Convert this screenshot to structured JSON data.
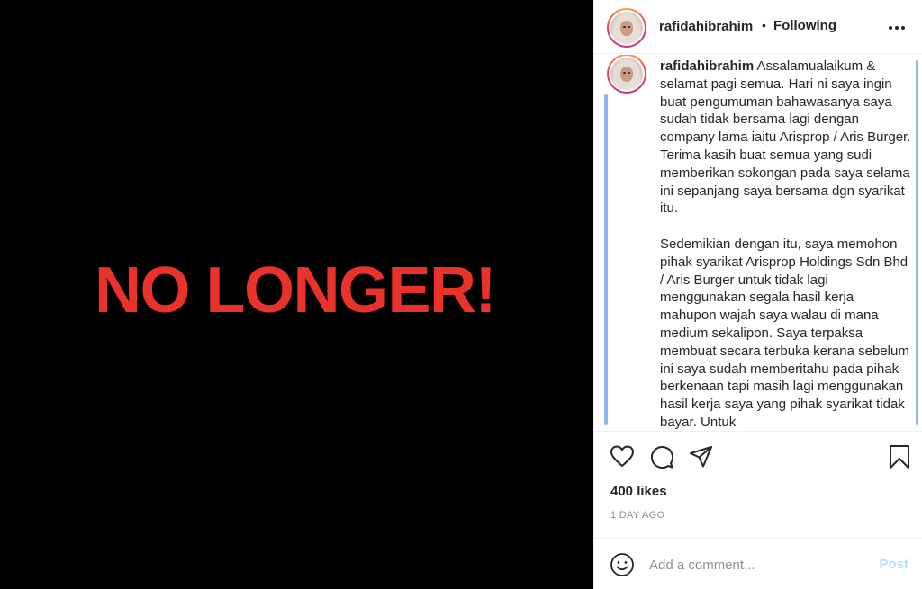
{
  "media": {
    "text": "NO LONGER!"
  },
  "header": {
    "username": "rafidahibrahim",
    "separator": "•",
    "follow_status": "Following"
  },
  "caption": {
    "username": "rafidahibrahim",
    "text": " Assalamualaikum & selamat pagi semua. Hari ni saya ingin buat pengumuman bahawasanya saya sudah tidak bersama lagi dengan company lama iaitu Arisprop / Aris Burger. Terima kasih buat semua yang sudi memberikan sokongan pada saya selama ini sepanjang saya bersama dgn syarikat itu.\n\nSedemikian dengan itu, saya memohon pihak syarikat Arisprop Holdings Sdn Bhd / Aris Burger untuk tidak lagi menggunakan segala hasil kerja mahupon wajah saya walau di mana medium sekalipon. Saya terpaksa membuat secara terbuka kerana sebelum ini saya sudah memberitahu pada pihak berkenaan tapi masih lagi menggunakan hasil kerja saya yang pihak syarikat tidak bayar. Untuk"
  },
  "stats": {
    "likes": "400 likes",
    "time": "1 DAY AGO"
  },
  "comment_box": {
    "placeholder": "Add a comment...",
    "post_label": "Post"
  },
  "colors": {
    "media_text": "#e8322a",
    "post_disabled": "#b2dffc",
    "scroll_highlight": "#8fb5f0"
  }
}
